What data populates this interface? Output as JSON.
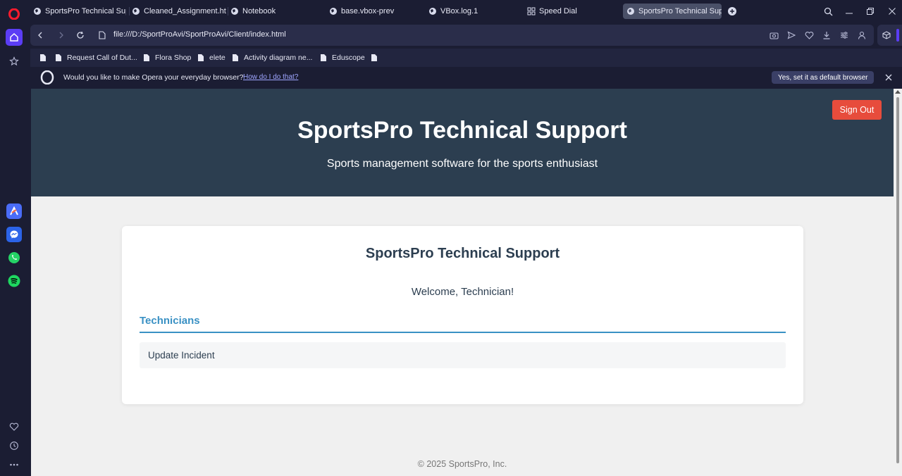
{
  "browser": {
    "tabs": [
      {
        "label": "SportsPro Technical Support"
      },
      {
        "label": "Cleaned_Assignment.html"
      },
      {
        "label": "Notebook"
      },
      {
        "label": "base.vbox-prev"
      },
      {
        "label": "VBox.log.1"
      },
      {
        "label": "Speed Dial"
      },
      {
        "label": "SportsPro Technical Support"
      }
    ],
    "url": "file:///D:/SportProAvi/SportProAvi/Client/index.html",
    "bookmarks": [
      {
        "label": ""
      },
      {
        "label": "Request Call of Dut..."
      },
      {
        "label": "Flora Shop"
      },
      {
        "label": "elete"
      },
      {
        "label": "Activity diagram ne..."
      },
      {
        "label": "Eduscope"
      },
      {
        "label": ""
      }
    ],
    "notification": {
      "text": "Would you like to make Opera your everyday browser?",
      "link": "How do I do that?",
      "button": "Yes, set it as default browser"
    }
  },
  "page": {
    "hero_title": "SportsPro Technical Support",
    "hero_subtitle": "Sports management software for the sports enthusiast",
    "signout_label": "Sign Out",
    "card_title": "SportsPro Technical Support",
    "welcome": "Welcome, Technician!",
    "section_heading": "Technicians",
    "menu_items": [
      {
        "label": "Update Incident"
      }
    ],
    "footer": "© 2025 SportsPro, Inc."
  },
  "colors": {
    "hero_bg": "#2c3e50",
    "signout_bg": "#e74c3c",
    "section_accent": "#3a91c4",
    "browser_chrome": "#1b1d33",
    "opera_accent": "#5b3df5"
  }
}
